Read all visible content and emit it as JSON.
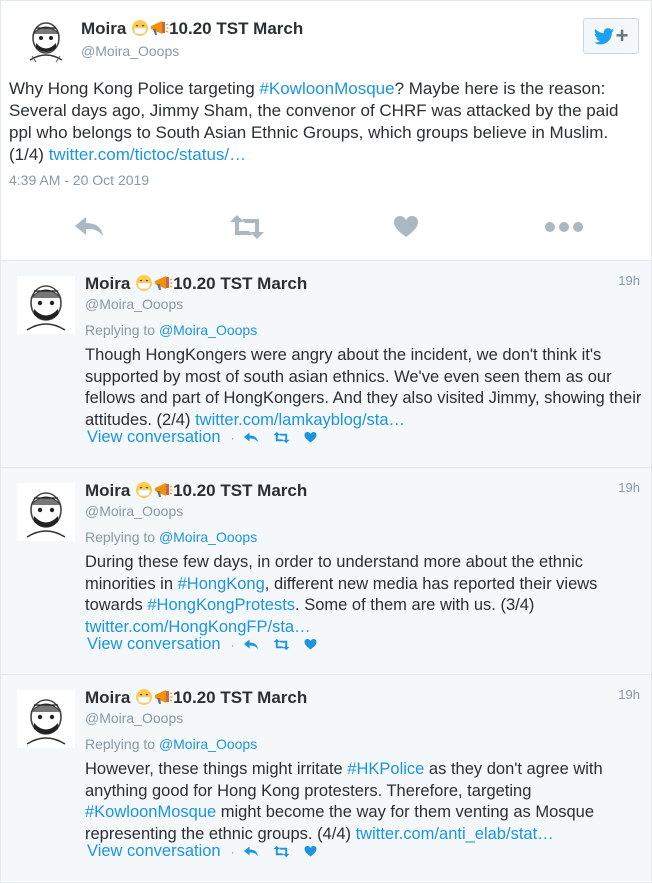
{
  "main_tweet": {
    "author_name": "Moira",
    "author_suffix": "10.20 TST March",
    "handle": "@Moira_Ooops",
    "text_parts": {
      "t1": "Why Hong Kong Police targeting ",
      "hashtag": "#KowloonMosque",
      "t2": "? Maybe here is the reason: Several days ago, Jimmy Sham, the convenor of CHRF was attacked by the paid ppl who belongs to South Asian Ethnic Groups, which groups believe in Muslim. (1/4) ",
      "link": "twitter.com/tictoc/status/…"
    },
    "timestamp": "4:39 AM - 20 Oct 2019",
    "icons": [
      "reply-icon",
      "retweet-icon",
      "like-icon",
      "more-icon"
    ]
  },
  "follow_button": {
    "icon": "twitter-bird-icon",
    "plus": "+"
  },
  "replies": [
    {
      "author_name": "Moira",
      "author_suffix": "10.20 TST March",
      "handle": "@Moira_Ooops",
      "time": "19h",
      "replying_label": "Replying to",
      "replying_handle": "@Moira_Ooops",
      "parts": {
        "t1": "Though HongKongers were angry about the incident, we don't think it's supported by most of south asian ethnics. We've even seen them as our fellows and part of HongKongers. And they also visited Jimmy, showing their attitudes. (2/4) ",
        "link": "twitter.com/lamkayblog/sta…"
      },
      "view_conversation": "View conversation",
      "separator": "·"
    },
    {
      "author_name": "Moira",
      "author_suffix": "10.20 TST March",
      "handle": "@Moira_Ooops",
      "time": "19h",
      "replying_label": "Replying to",
      "replying_handle": "@Moira_Ooops",
      "parts": {
        "t1": "During these few days, in order to understand more about the ethnic minorities in ",
        "h1": "#HongKong",
        "t2": ", different new media has reported their views towards ",
        "h2": "#HongKongProtests",
        "t3": ". Some of them are with us. (3/4) ",
        "link": "twitter.com/HongKongFP/sta…"
      },
      "view_conversation": "View conversation",
      "separator": "·"
    },
    {
      "author_name": "Moira",
      "author_suffix": "10.20 TST March",
      "handle": "@Moira_Ooops",
      "time": "19h",
      "replying_label": "Replying to",
      "replying_handle": "@Moira_Ooops",
      "parts": {
        "t1": "However, these things might irritate ",
        "h1": "#HKPolice",
        "t2": " as they don't agree with anything good for Hong Kong protesters. Therefore, targeting ",
        "h2": "#KowloonMosque",
        "t3": " might become the way for them venting as Mosque representing the ethnic groups. (4/4) ",
        "link": "twitter.com/anti_elab/stat…"
      },
      "view_conversation": "View conversation",
      "separator": "·"
    }
  ],
  "colors": {
    "link": "#1b95e0",
    "text": "#292f33",
    "muted": "#8899a6",
    "icon": "#aab8c2",
    "twitter_blue": "#1da1f2",
    "reply_bg": "#f5f8fa",
    "emoji_yellow": "#ffcc4d",
    "megaphone_orange": "#f4900c"
  }
}
